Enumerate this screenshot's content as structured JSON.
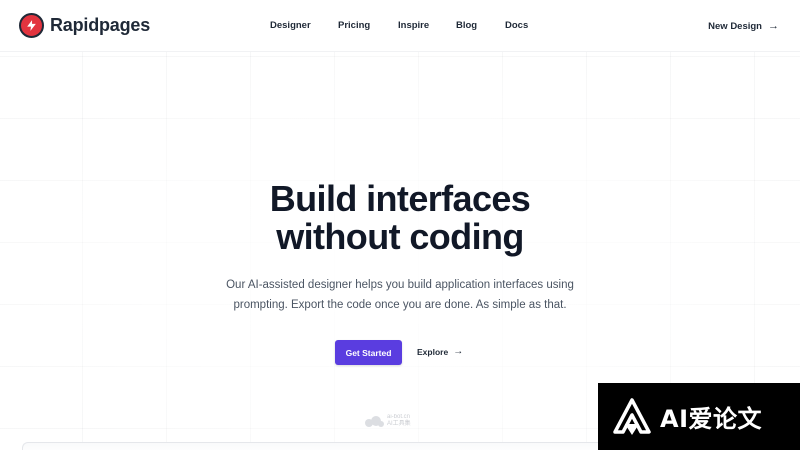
{
  "brand": {
    "name": "Rapidpages",
    "logo_icon": "lightning-icon",
    "logo_color": "#e2343f"
  },
  "nav": {
    "items": [
      {
        "label": "Designer"
      },
      {
        "label": "Pricing"
      },
      {
        "label": "Inspire"
      },
      {
        "label": "Blog"
      },
      {
        "label": "Docs"
      }
    ],
    "new_design": {
      "label": "New Design",
      "arrow": "→"
    }
  },
  "hero": {
    "title_line1": "Build interfaces",
    "title_line2": "without coding",
    "subtitle_line1": "Our AI-assisted designer helps you build application interfaces using",
    "subtitle_line2": "prompting. Export the code once you are done. As simple as that.",
    "primary_cta": "Get Started",
    "secondary_cta": "Explore",
    "secondary_arrow": "→"
  },
  "colors": {
    "accent": "#5a3de0",
    "text": "#111827",
    "muted": "#4b5563"
  },
  "watermark": {
    "center_line1": "ai-bot.cn",
    "center_line2": "AI工具集",
    "badge_text": "AI爱论文"
  }
}
